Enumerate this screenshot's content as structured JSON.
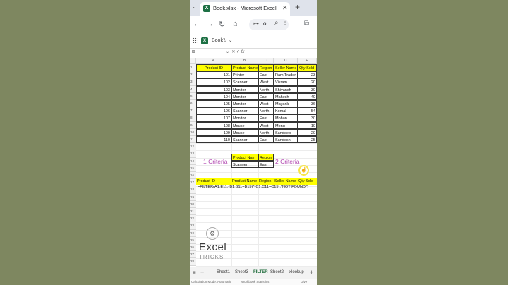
{
  "browser": {
    "tab_title": "Book.xlsx - Microsoft Excel Online",
    "tab_icon": "excel-icon",
    "url_text": "o...",
    "new_tab_label": "+"
  },
  "app": {
    "book_name": "Book"
  },
  "formula_bar": {
    "name_box": "I9",
    "fx_label": "fx"
  },
  "grid": {
    "columns": [
      "A",
      "B",
      "C",
      "D",
      "E"
    ],
    "row_numbers": [
      "1",
      "2",
      "3",
      "4",
      "5",
      "6",
      "7",
      "8",
      "9",
      "10",
      "11",
      "12",
      "13",
      "14",
      "15",
      "16",
      "17",
      "18",
      "19",
      "20",
      "21",
      "22",
      "23",
      "24",
      "25",
      "26",
      "27",
      "28"
    ],
    "data_headers": [
      "Product ID",
      "Product Name",
      "Region",
      "Seller Name",
      "Qty Sold"
    ],
    "data_rows": [
      [
        "101",
        "Printer",
        "East",
        "Ram Trader",
        "23"
      ],
      [
        "102",
        "Scanner",
        "West",
        "Vikram",
        "20"
      ],
      [
        "103",
        "Monitor",
        "North",
        "Shivansh",
        "30"
      ],
      [
        "104",
        "Monitor",
        "East",
        "Mahesh",
        "40"
      ],
      [
        "105",
        "Monitor",
        "West",
        "Mayank",
        "36"
      ],
      [
        "106",
        "Scanner",
        "North",
        "Komal",
        "54"
      ],
      [
        "107",
        "Monitor",
        "East",
        "Mohan",
        "30"
      ],
      [
        "108",
        "Mouse",
        "West",
        "Monu",
        "10"
      ],
      [
        "109",
        "Mouse",
        "North",
        "Sandeep",
        "20"
      ],
      [
        "110",
        "Scanner",
        "East",
        "Sandesh",
        "25"
      ]
    ],
    "criteria_headers": [
      "Product Nam",
      "Region"
    ],
    "criteria_values": [
      "Scanner",
      "East"
    ],
    "annotation_1": "1 Criteria",
    "annotation_2": "2 Criteria",
    "result_headers": [
      "Product ID",
      "Product Name",
      "Region",
      "Seller Name",
      "Qty Sold"
    ],
    "formula": "=FILTER(A1:E11,(B1:B11=B15)*(C1:C11=C15),\"NOT FOUND\")"
  },
  "watermark": {
    "title": "Excel",
    "subtitle": "TRICKS"
  },
  "sheet_tabs": [
    "Sheet1",
    "Sheet3",
    "FILTER",
    "Sheet2",
    "xlookup"
  ],
  "active_sheet": "FILTER",
  "status_bar": {
    "calc_mode": "Calculation Mode: Automatic",
    "stats": "Workbook Statistics",
    "feedback": "Give Feedback"
  },
  "colors": {
    "header_fill": "#ffff00",
    "annotation": "#b148b1",
    "excel_green": "#1d7044",
    "background": "#7e8760"
  }
}
